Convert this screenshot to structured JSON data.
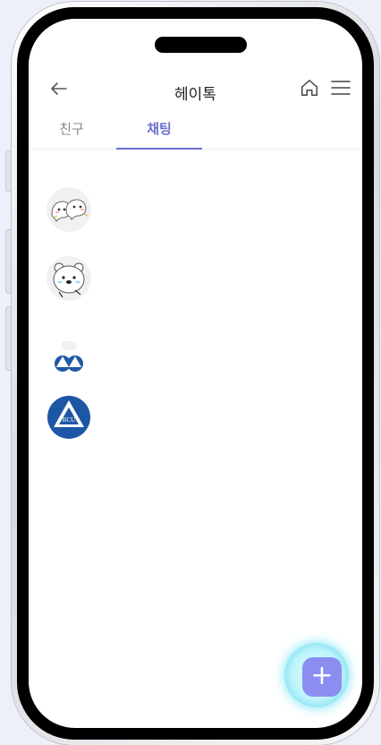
{
  "header": {
    "title": "헤이톡",
    "back_icon": "arrow-left-icon",
    "home_icon": "home-icon",
    "menu_icon": "hamburger-menu-icon"
  },
  "tabs": [
    {
      "label": "친구",
      "active": false
    },
    {
      "label": "채팅",
      "active": true
    }
  ],
  "chats": [
    {
      "avatar": "ghost-sticker-avatar"
    },
    {
      "avatar": "bear-sticker-avatar"
    },
    {
      "avatar": "bcu-two-logos-avatar"
    },
    {
      "avatar": "bcu-logo-avatar",
      "logo_text": "BCU"
    }
  ],
  "fab": {
    "label": "+",
    "icon": "plus-icon"
  },
  "colors": {
    "accent": "#6a6fd0",
    "fab": "#8b8ef0",
    "fab_glow": "#a9eef8"
  }
}
